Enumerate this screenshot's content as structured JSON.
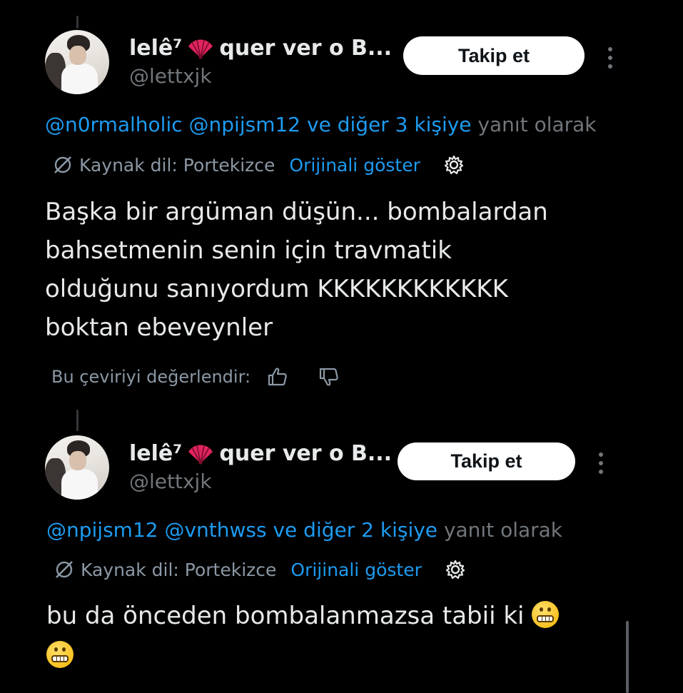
{
  "tweets": [
    {
      "display_name": "lelê⁷",
      "display_name_suffix": "quer ver o B...",
      "handle": "@lettxjk",
      "follow_label": "Takip et",
      "reply_mentions": "@n0rmalholic @npijsm12 ve diğer 3 kişiye",
      "reply_suffix": "yanıt olarak",
      "source_lang": "Kaynak dil: Portekizce",
      "show_original": "Orijinali göster",
      "text_lines": [
        "Başka bir argüman düşün... bombalardan",
        "bahsetmenin senin için travmatik",
        "olduğunu sanıyordum KKKKKKKKKKKK",
        "boktan ebeveynler"
      ],
      "rate_label": "Bu çeviriyi değerlendir:"
    },
    {
      "display_name": "lelê⁷",
      "display_name_suffix": "quer ver o B...",
      "handle": "@lettxjk",
      "follow_label": "Takip et",
      "reply_mentions": "@npijsm12 @vnthwss ve diğer 2 kişiye",
      "reply_suffix": "yanıt olarak",
      "source_lang": "Kaynak dil: Portekizce",
      "show_original": "Orijinali göster",
      "text_line_1": "bu da önceden bombalanmazsa tabii ki"
    }
  ],
  "icons": {
    "name_emoji": "folding-fan-icon",
    "translate": "translate-slash-icon",
    "settings": "gear-icon",
    "thumbs_up": "thumbs-up-icon",
    "thumbs_down": "thumbs-down-icon",
    "text_emoji": "grimacing-face-emoji"
  },
  "colors": {
    "background": "#000000",
    "text": "#e7e9ea",
    "secondary": "#71767b",
    "link": "#1d9bf0",
    "button_bg": "#ffffff",
    "fan": "#e0245e"
  }
}
